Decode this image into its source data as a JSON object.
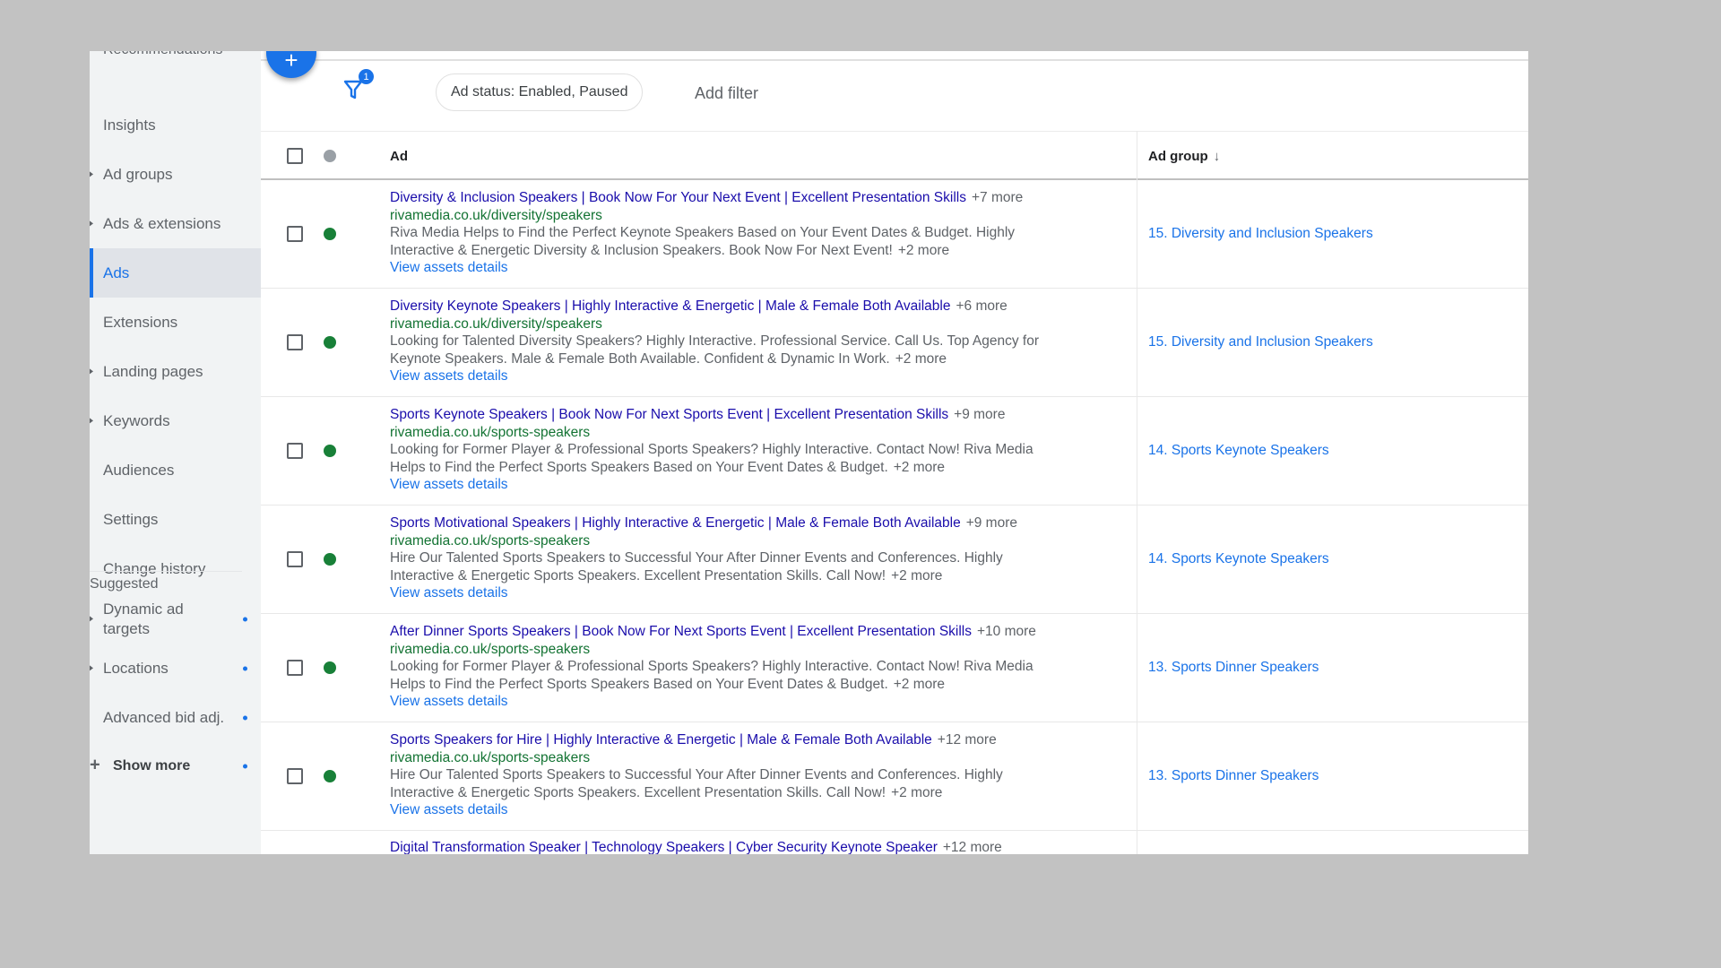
{
  "sidebar": {
    "cut_top_item": "Recommendations",
    "items": [
      {
        "label": "Insights",
        "expander": false
      },
      {
        "label": "Ad groups",
        "expander": true
      },
      {
        "label": "Ads & extensions",
        "expander": true
      },
      {
        "label": "Ads",
        "expander": false,
        "active": true
      },
      {
        "label": "Extensions",
        "expander": false
      },
      {
        "label": "Landing pages",
        "expander": true
      },
      {
        "label": "Keywords",
        "expander": true
      },
      {
        "label": "Audiences",
        "expander": false
      },
      {
        "label": "Settings",
        "expander": false
      },
      {
        "label": "Change history",
        "expander": false
      }
    ],
    "section_label": "Suggested",
    "suggested": [
      {
        "label_line1": "Dynamic ad",
        "label_line2": "targets"
      },
      {
        "label": "Locations"
      },
      {
        "label": "Advanced bid adj."
      },
      {
        "label": "Show more"
      }
    ]
  },
  "toolbar": {
    "fab_icon": "+",
    "filter_badge": "1",
    "filter_chip": "Ad status: Enabled, Paused",
    "add_filter": "Add filter"
  },
  "table": {
    "columns": {
      "ad": "Ad",
      "ad_group": "Ad group",
      "sort_icon": "↓"
    },
    "rows": [
      {
        "headline": "Diversity & Inclusion Speakers | Book Now For Your Next Event | Excellent Presentation Skills",
        "headline_more": "+7 more",
        "url": "rivamedia.co.uk/diversity/speakers",
        "desc1": "Riva Media Helps to Find the Perfect Keynote Speakers Based on Your Event Dates & Budget. Highly",
        "desc2": "Interactive & Energetic Diversity & Inclusion Speakers. Book Now For Next Event!",
        "desc_more": "+2 more",
        "link": "View assets details",
        "ad_group": "15. Diversity and Inclusion Speakers"
      },
      {
        "headline": "Diversity Keynote Speakers | Highly Interactive & Energetic | Male & Female Both Available",
        "headline_more": "+6 more",
        "url": "rivamedia.co.uk/diversity/speakers",
        "desc1": "Looking for Talented Diversity Speakers? Highly Interactive. Professional Service. Call Us. Top Agency for",
        "desc2": "Keynote Speakers. Male & Female Both Available. Confident & Dynamic In Work.",
        "desc_more": "+2 more",
        "link": "View assets details",
        "ad_group": "15. Diversity and Inclusion Speakers"
      },
      {
        "headline": "Sports Keynote Speakers | Book Now For Next Sports Event | Excellent Presentation Skills",
        "headline_more": "+9 more",
        "url": "rivamedia.co.uk/sports-speakers",
        "desc1": "Looking for Former Player & Professional Sports Speakers? Highly Interactive. Contact Now! Riva Media",
        "desc2": "Helps to Find the Perfect Sports Speakers Based on Your Event Dates & Budget.",
        "desc_more": "+2 more",
        "link": "View assets details",
        "ad_group": "14. Sports Keynote Speakers"
      },
      {
        "headline": "Sports Motivational Speakers | Highly Interactive & Energetic | Male & Female Both Available",
        "headline_more": "+9 more",
        "url": "rivamedia.co.uk/sports-speakers",
        "desc1": "Hire Our Talented Sports Speakers to Successful Your After Dinner Events and Conferences. Highly",
        "desc2": "Interactive & Energetic Sports Speakers. Excellent Presentation Skills. Call Now!",
        "desc_more": "+2 more",
        "link": "View assets details",
        "ad_group": "14. Sports Keynote Speakers"
      },
      {
        "headline": "After Dinner Sports Speakers | Book Now For Next Sports Event | Excellent Presentation Skills",
        "headline_more": "+10 more",
        "url": "rivamedia.co.uk/sports-speakers",
        "desc1": "Looking for Former Player & Professional Sports Speakers? Highly Interactive. Contact Now! Riva Media",
        "desc2": "Helps to Find the Perfect Sports Speakers Based on Your Event Dates & Budget.",
        "desc_more": "+2 more",
        "link": "View assets details",
        "ad_group": "13. Sports Dinner Speakers"
      },
      {
        "headline": "Sports Speakers for Hire | Highly Interactive & Energetic | Male & Female Both Available",
        "headline_more": "+12 more",
        "url": "rivamedia.co.uk/sports-speakers",
        "desc1": "Hire Our Talented Sports Speakers to Successful Your After Dinner Events and Conferences. Highly",
        "desc2": "Interactive & Energetic Sports Speakers. Excellent Presentation Skills. Call Now!",
        "desc_more": "+2 more",
        "link": "View assets details",
        "ad_group": "13. Sports Dinner Speakers"
      }
    ],
    "partial_row": {
      "headline": "Digital Transformation Speaker | Technology Speakers | Cyber Security Keynote Speaker",
      "headline_more": "+12 more"
    }
  },
  "colors": {
    "accent": "#1a73e8",
    "status_enabled": "#188038",
    "status_header": "#9aa0a6",
    "headline": "#1a0dab",
    "url_green": "#137333"
  }
}
